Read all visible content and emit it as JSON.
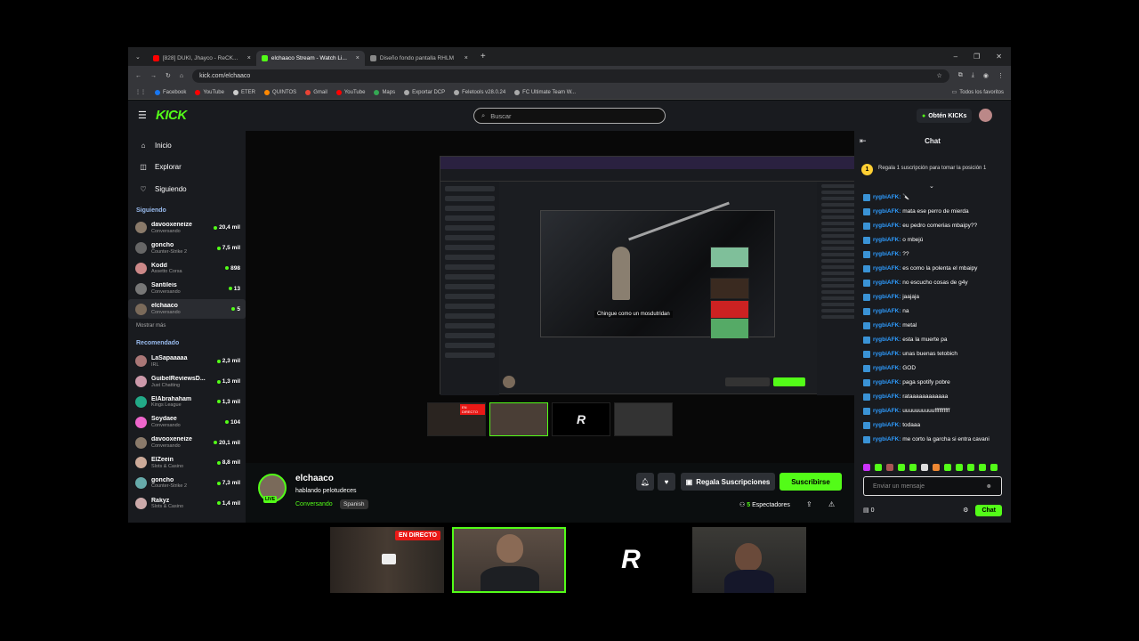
{
  "browser": {
    "tabs": [
      {
        "title": "[828] DUKI, Jhayco - ReCK...",
        "color": "#ff0000",
        "active": false
      },
      {
        "title": "elchaaco Stream - Watch Li...",
        "color": "#53fc18",
        "active": true
      },
      {
        "title": "Diseño fondo pantalla RHLM",
        "color": "#888888",
        "active": false
      }
    ],
    "url": "kick.com/elchaaco",
    "bookmarks": [
      "Facebook",
      "YouTube",
      "ETER",
      "QUINTOS",
      "Gmail",
      "YouTube",
      "Maps",
      "Exportar DCP",
      "Feletools v28.0.24",
      "FC Ultimate Team W..."
    ],
    "bookmarks_folder": "Todos los favoritos"
  },
  "kick": {
    "logo": "KICK",
    "search_placeholder": "Buscar",
    "obten_label": "Obtén KICKs",
    "nav": [
      {
        "label": "Inicio",
        "icon": "home-icon"
      },
      {
        "label": "Explorar",
        "icon": "compass-icon"
      },
      {
        "label": "Siguiendo",
        "icon": "heart-icon"
      }
    ],
    "following_title": "Siguiendo",
    "following": [
      {
        "name": "davooxeneize",
        "category": "Conversando",
        "viewers": "20,4 mil"
      },
      {
        "name": "goncho",
        "category": "Counter-Strike 2",
        "viewers": "7,5 mil"
      },
      {
        "name": "Kodd",
        "category": "Assetto Corsa",
        "viewers": "898"
      },
      {
        "name": "Santileis",
        "category": "Conversando",
        "viewers": "13"
      },
      {
        "name": "elchaaco",
        "category": "Conversando",
        "viewers": "5"
      }
    ],
    "show_more": "Mostrar más",
    "recommended_title": "Recomendado",
    "recommended": [
      {
        "name": "LaSapaaaaa",
        "category": "IRL",
        "viewers": "2,3 mil"
      },
      {
        "name": "GuibelReviewsD...",
        "category": "Just Chatting",
        "viewers": "1,3 mil"
      },
      {
        "name": "ElAbrahaham",
        "category": "Kings League",
        "viewers": "1,3 mil"
      },
      {
        "name": "Soydaee",
        "category": "Conversando",
        "viewers": "104"
      },
      {
        "name": "davooxeneize",
        "category": "Conversando",
        "viewers": "20,1 mil"
      },
      {
        "name": "ElZeein",
        "category": "Slots & Casino",
        "viewers": "8,8 mil"
      },
      {
        "name": "goncho",
        "category": "Counter-Strike 2",
        "viewers": "7,3 mil"
      },
      {
        "name": "Rakyz",
        "category": "Slots & Casino",
        "viewers": "1,4 mil"
      }
    ]
  },
  "stream": {
    "channel": "elchaaco",
    "title": "hablando pelotudeces",
    "category": "Conversando",
    "language": "Spanish",
    "live_badge": "LIVE",
    "gift_label": "Regala Suscripciones",
    "subscribe_label": "Suscribirse",
    "viewers_count": "5",
    "viewers_label": "Espectadores",
    "nested_subtitle": "Chingue como un mosdutridan"
  },
  "chat": {
    "title": "Chat",
    "pinned": "Regala 1 suscripción para tomar la posición 1",
    "pinned_rank": "1",
    "messages": [
      {
        "user": "rygbiAFK",
        "text": "🔪"
      },
      {
        "user": "rygbiAFK",
        "text": "mata ese perro de mierda"
      },
      {
        "user": "rygbiAFK",
        "text": "eu pedro comerias mbaipy??"
      },
      {
        "user": "rygbiAFK",
        "text": "o mbejú"
      },
      {
        "user": "rygbiAFK",
        "text": "??"
      },
      {
        "user": "rygbiAFK",
        "text": "es como la polenta el mbaipy"
      },
      {
        "user": "rygbiAFK",
        "text": "no escucho cosas de g4y"
      },
      {
        "user": "rygbiAFK",
        "text": "jaajaja"
      },
      {
        "user": "rygbiAFK",
        "text": "na"
      },
      {
        "user": "rygbiAFK",
        "text": "metal"
      },
      {
        "user": "rygbiAFK",
        "text": "esta la muerte pa"
      },
      {
        "user": "rygbiAFK",
        "text": "unas buenas tetobich"
      },
      {
        "user": "rygbiAFK",
        "text": "GOD"
      },
      {
        "user": "rygbiAFK",
        "text": "paga spotify pobre"
      },
      {
        "user": "rygbiAFK",
        "text": "rataaaaaaaaaaaa"
      },
      {
        "user": "rygbiAFK",
        "text": "uuuuuuuuuuffffffffff"
      },
      {
        "user": "rygbiAFK",
        "text": "todaaa"
      },
      {
        "user": "rygbiAFK",
        "text": "me corto la garcha si entra cavani"
      }
    ],
    "input_placeholder": "Enviar un mensaje",
    "kicks_count": "0",
    "send_label": "Chat"
  },
  "overlay": {
    "live_label": "EN DIRECTO",
    "logo_letter": "R"
  },
  "colors": {
    "accent": "#53fc18",
    "bg": "#0b0e0f",
    "panel": "#191b1f",
    "live": "#e91916",
    "username": "#2e9cff"
  }
}
